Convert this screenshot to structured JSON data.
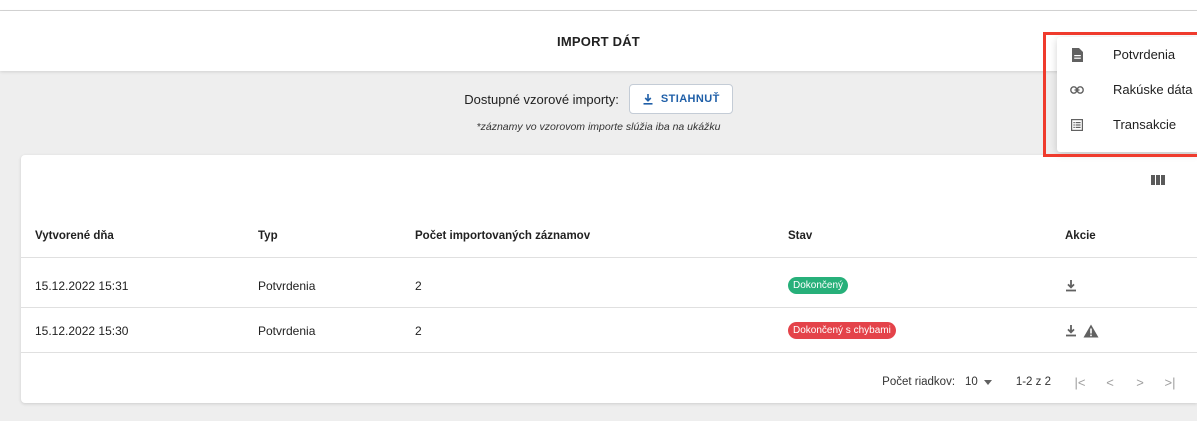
{
  "header": {
    "title": "IMPORT DÁT"
  },
  "samples": {
    "label": "Dostupné vzorové importy:",
    "download_label": "STIAHNUŤ",
    "note": "*záznamy vo vzorovom importe slúžia iba na ukážku"
  },
  "table": {
    "columns": [
      "Vytvorené dňa",
      "Typ",
      "Počet importovaných záznamov",
      "Stav",
      "Akcie"
    ],
    "rows": [
      {
        "created": "15.12.2022 15:31",
        "type": "Potvrdenia",
        "count": "2",
        "status": "Dokončený",
        "status_color": "#27b07a",
        "actions": [
          "download-icon"
        ]
      },
      {
        "created": "15.12.2022 15:30",
        "type": "Potvrdenia",
        "count": "2",
        "status": "Dokončený s chybami",
        "status_color": "#e4434a",
        "actions": [
          "download-icon",
          "warning-icon"
        ]
      }
    ]
  },
  "pagination": {
    "rows_label": "Počet riadkov:",
    "rows_value": "10",
    "range": "1-2 z 2",
    "first": "|<",
    "prev": "<",
    "next": ">",
    "last": ">|"
  },
  "menu": {
    "items": [
      {
        "label": "Potvrdenia",
        "icon": "document-icon"
      },
      {
        "label": "Rakúske dáta",
        "icon": "link-icon"
      },
      {
        "label": "Transakcie",
        "icon": "list-icon"
      }
    ]
  },
  "colors": {
    "accent": "#1f5fa8",
    "success": "#27b07a",
    "error": "#e4434a",
    "highlight": "#ef3b2d",
    "background": "#eeeeee"
  }
}
